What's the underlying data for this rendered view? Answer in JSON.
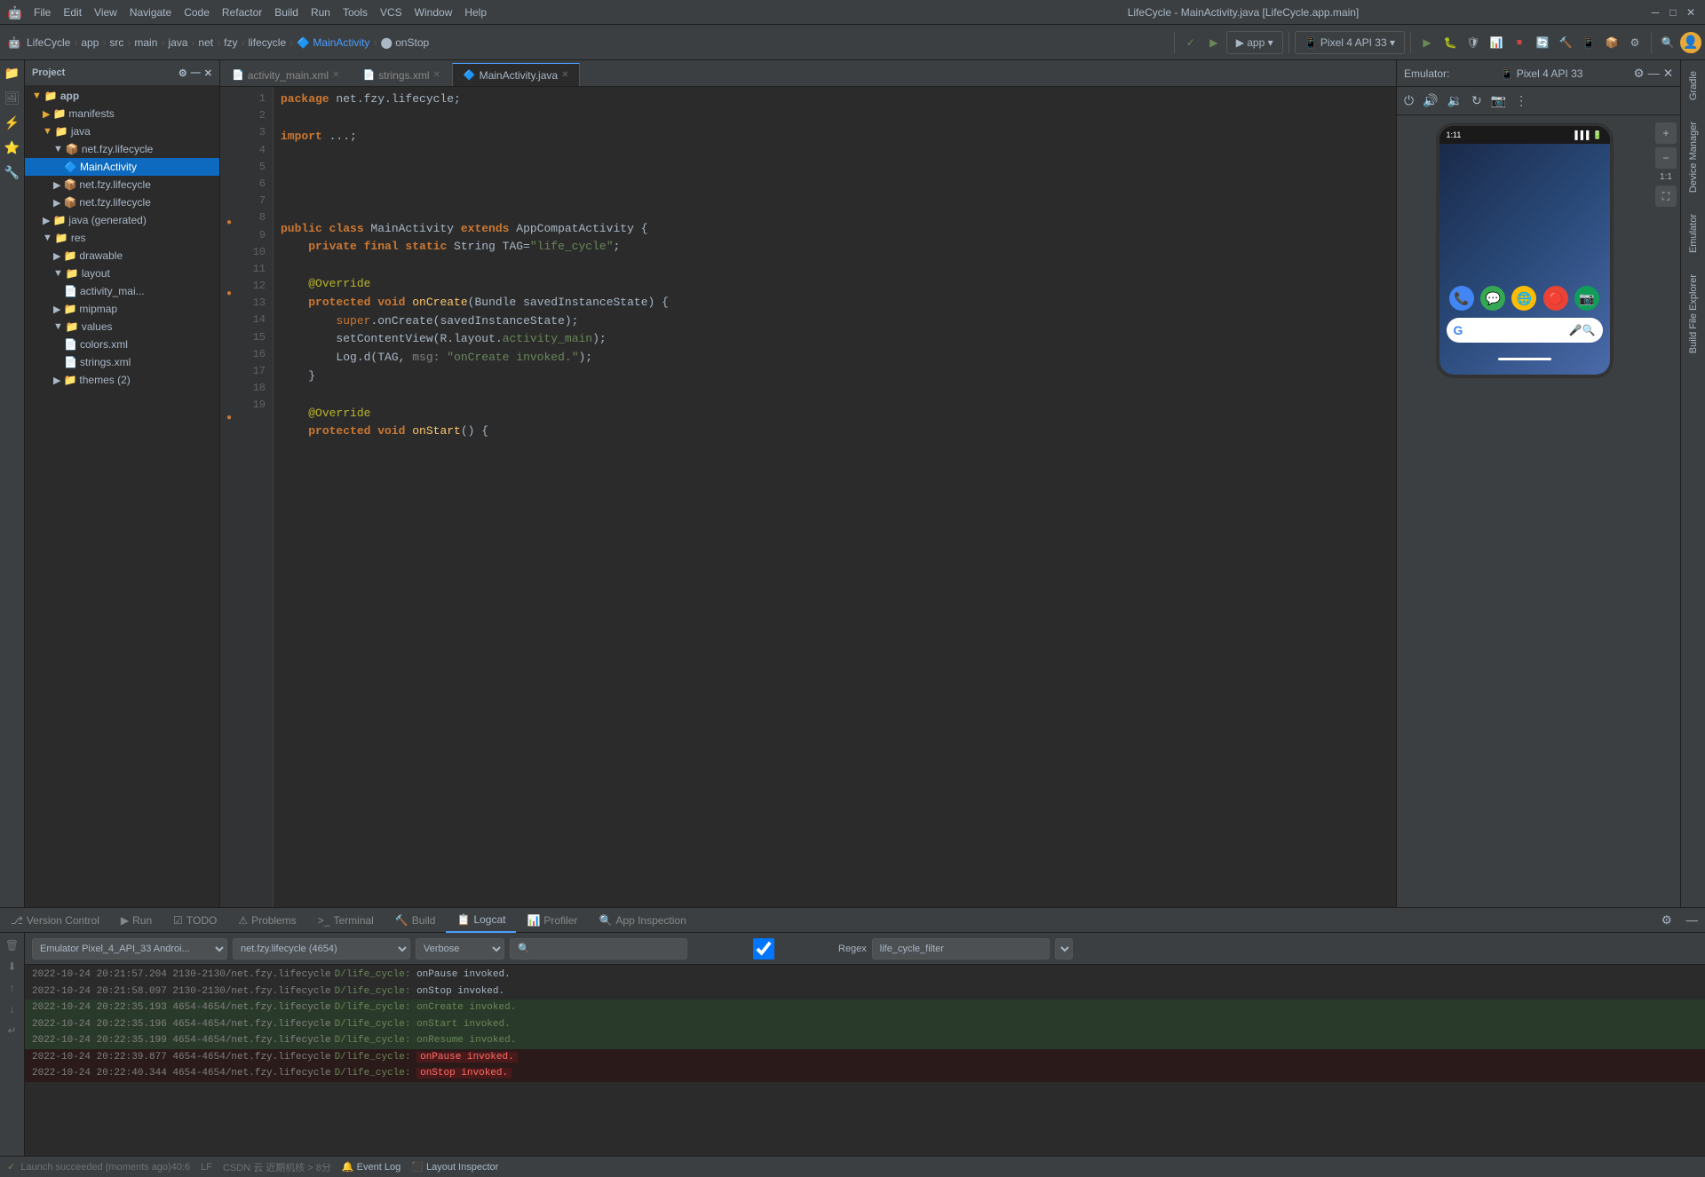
{
  "titleBar": {
    "appIcon": "🤖",
    "menu": [
      "File",
      "Edit",
      "View",
      "Navigate",
      "Code",
      "Refactor",
      "Build",
      "Run",
      "Tools",
      "VCS",
      "Window",
      "Help"
    ],
    "windowTitle": "LifeCycle - MainActivity.java [LifeCycle.app.main]",
    "minimize": "─",
    "maximize": "□",
    "close": "✕"
  },
  "toolbar": {
    "breadcrumb": {
      "items": [
        "LifeCycle",
        "app",
        "src",
        "main",
        "java",
        "net",
        "fzy",
        "lifecycle",
        "MainActivity",
        "onStop"
      ]
    },
    "deviceDropdown": "▼ app",
    "emulatorDropdown": "Pixel 4 API 33",
    "runBtn": "▶",
    "debugBtn": "🐛",
    "stopBtn": "⏹"
  },
  "projectPanel": {
    "title": "Project",
    "tree": [
      {
        "level": 0,
        "icon": "▶",
        "iconType": "folder",
        "label": "app",
        "selected": false
      },
      {
        "level": 1,
        "icon": "▶",
        "iconType": "folder",
        "label": "manifests",
        "selected": false
      },
      {
        "level": 1,
        "icon": "▼",
        "iconType": "folder",
        "label": "java",
        "selected": false
      },
      {
        "level": 2,
        "icon": "▼",
        "iconType": "package",
        "label": "net.fzy.lifecycle",
        "selected": false
      },
      {
        "level": 3,
        "icon": "🔷",
        "iconType": "java",
        "label": "MainActivity",
        "selected": true
      },
      {
        "level": 2,
        "icon": "▶",
        "iconType": "package",
        "label": "net.fzy.lifecycle",
        "selected": false
      },
      {
        "level": 2,
        "icon": "▶",
        "iconType": "package",
        "label": "net.fzy.lifecycle",
        "selected": false
      },
      {
        "level": 1,
        "icon": "▶",
        "iconType": "folder",
        "label": "java (generated)",
        "selected": false
      },
      {
        "level": 1,
        "icon": "▼",
        "iconType": "folder",
        "label": "res",
        "selected": false
      },
      {
        "level": 2,
        "icon": "▶",
        "iconType": "folder",
        "label": "drawable",
        "selected": false
      },
      {
        "level": 2,
        "icon": "▼",
        "iconType": "folder",
        "label": "layout",
        "selected": false
      },
      {
        "level": 3,
        "icon": "📄",
        "iconType": "xml",
        "label": "activity_mai...",
        "selected": false
      },
      {
        "level": 2,
        "icon": "▶",
        "iconType": "folder",
        "label": "mipmap",
        "selected": false
      },
      {
        "level": 2,
        "icon": "▼",
        "iconType": "folder",
        "label": "values",
        "selected": false
      },
      {
        "level": 3,
        "icon": "📄",
        "iconType": "xml",
        "label": "colors.xml",
        "selected": false
      },
      {
        "level": 3,
        "icon": "📄",
        "iconType": "xml",
        "label": "strings.xml",
        "selected": false
      },
      {
        "level": 2,
        "icon": "▶",
        "iconType": "folder",
        "label": "themes (2)",
        "selected": false
      }
    ]
  },
  "tabs": [
    {
      "label": "activity_main.xml",
      "icon": "📄",
      "active": false
    },
    {
      "label": "strings.xml",
      "icon": "📄",
      "active": false
    },
    {
      "label": "MainActivity.java",
      "icon": "🔷",
      "active": true
    }
  ],
  "codeLines": [
    {
      "num": 1,
      "code": "package net.fzy.lifecycle;",
      "gutter": ""
    },
    {
      "num": 2,
      "code": "",
      "gutter": ""
    },
    {
      "num": 3,
      "code": "import ...;",
      "gutter": ""
    },
    {
      "num": 4,
      "code": "",
      "gutter": ""
    },
    {
      "num": 5,
      "code": "",
      "gutter": ""
    },
    {
      "num": 6,
      "code": "",
      "gutter": ""
    },
    {
      "num": 7,
      "code": "",
      "gutter": ""
    },
    {
      "num": 8,
      "code": "public class MainActivity extends AppCompatActivity {",
      "gutter": "●"
    },
    {
      "num": 9,
      "code": "    private final static String TAG=\"life_cycle\";",
      "gutter": ""
    },
    {
      "num": 10,
      "code": "",
      "gutter": ""
    },
    {
      "num": 11,
      "code": "    @Override",
      "gutter": ""
    },
    {
      "num": 12,
      "code": "    protected void onCreate(Bundle savedInstanceState) {",
      "gutter": "●"
    },
    {
      "num": 13,
      "code": "        super.onCreate(savedInstanceState);",
      "gutter": ""
    },
    {
      "num": 14,
      "code": "        setContentView(R.layout.activity_main);",
      "gutter": ""
    },
    {
      "num": 15,
      "code": "        Log.d(TAG, msg: \"onCreate invoked.\");",
      "gutter": ""
    },
    {
      "num": 16,
      "code": "    }",
      "gutter": ""
    },
    {
      "num": 17,
      "code": "",
      "gutter": ""
    },
    {
      "num": 18,
      "code": "    @Override",
      "gutter": ""
    },
    {
      "num": 19,
      "code": "    protected void onStart() {",
      "gutter": "●"
    }
  ],
  "emulator": {
    "headerLabel": "Emulator:",
    "deviceLabel": "Pixel 4 API 33",
    "phoneTime": "1:11",
    "phoneSignal": "▐▐▐",
    "phoneBattery": "🔋",
    "appIcons": [
      "📞",
      "📬",
      "🌐",
      "🔴",
      "📷"
    ],
    "searchPlaceholder": "G",
    "micIcon": "🎤",
    "lensIcon": "🔍"
  },
  "bottomTabs": [
    {
      "label": "Version Control",
      "icon": "",
      "active": false
    },
    {
      "label": "Run",
      "icon": "▶",
      "active": false
    },
    {
      "label": "TODO",
      "icon": "≡",
      "active": false
    },
    {
      "label": "Problems",
      "icon": "⚠",
      "active": false
    },
    {
      "label": "Terminal",
      "icon": ">_",
      "active": false
    },
    {
      "label": "Build",
      "icon": "🔨",
      "active": false
    },
    {
      "label": "Logcat",
      "icon": "📋",
      "active": true
    },
    {
      "label": "Profiler",
      "icon": "📊",
      "active": false
    },
    {
      "label": "App Inspection",
      "icon": "🔍",
      "active": false
    }
  ],
  "logcat": {
    "deviceFilter": "Emulator Pixel_4_API_33 Androi...",
    "packageFilter": "net.fzy.lifecycle (4654)",
    "levelFilter": "Verbose",
    "searchPlaceholder": "🔍",
    "regexLabel": "Regex",
    "filterValue": "life_cycle_filter",
    "logs": [
      {
        "time": "2022-10-24 20:21:57.204",
        "pid": "2130-2130/net.fzy.lifecycle",
        "level": "D/life_cycle:",
        "msg": "onPause invoked.",
        "type": "normal"
      },
      {
        "time": "2022-10-24 20:21:58.097",
        "pid": "2130-2130/net.fzy.lifecycle",
        "level": "D/life_cycle:",
        "msg": "onStop invoked.",
        "type": "normal"
      },
      {
        "time": "2022-10-24 20:22:35.193",
        "pid": "4654-4654/net.fzy.lifecycle",
        "level": "D/life_cycle:",
        "msg": "onCreate invoked.",
        "type": "green"
      },
      {
        "time": "2022-10-24 20:22:35.196",
        "pid": "4654-4654/net.fzy.lifecycle",
        "level": "D/life_cycle:",
        "msg": "onStart invoked.",
        "type": "green"
      },
      {
        "time": "2022-10-24 20:22:35.199",
        "pid": "4654-4654/net.fzy.lifecycle",
        "level": "D/life_cycle:",
        "msg": "onResume invoked.",
        "type": "green"
      },
      {
        "time": "2022-10-24 20:22:39.877",
        "pid": "4654-4654/net.fzy.lifecycle",
        "level": "D/life_cycle:",
        "msg": "onPause invoked.",
        "type": "red"
      },
      {
        "time": "2022-10-24 20:22:40.344",
        "pid": "4654-4654/net.fzy.lifecycle",
        "level": "D/life_cycle:",
        "msg": "onStop invoked.",
        "type": "red"
      }
    ]
  },
  "statusBar": {
    "message": "Launch succeeded (moments ago)",
    "cursorPos": "40:6",
    "lineEnding": "LF",
    "encoding": "CSDN 云 近期机核 > 8分",
    "eventLog": "Event Log",
    "layoutInspector": "Layout Inspector"
  }
}
